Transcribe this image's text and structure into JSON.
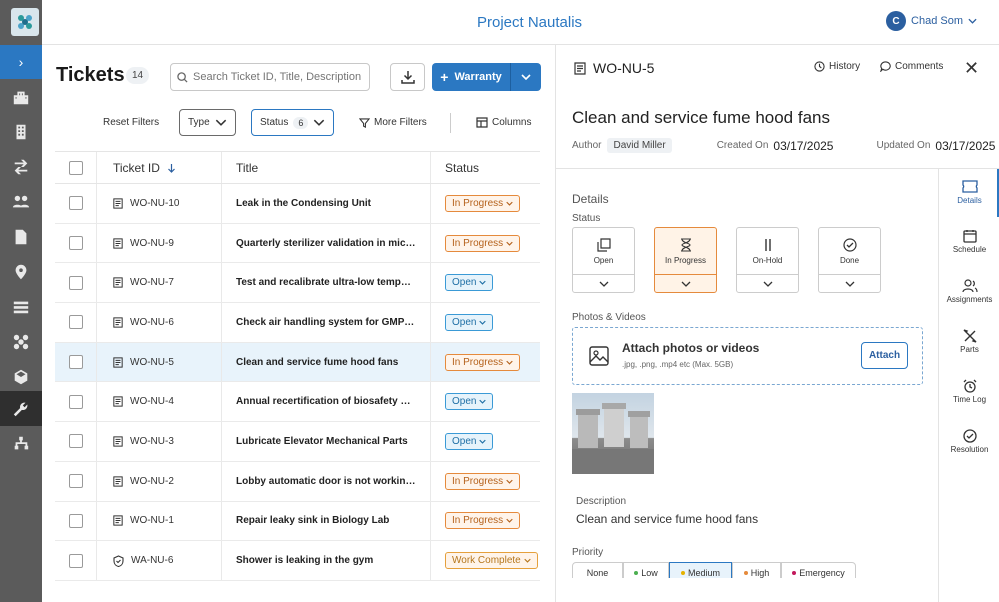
{
  "app": {
    "project_name": "Project Nautalis",
    "user_initial": "C",
    "user_name": "Chad Som"
  },
  "sidebar": {
    "items": [
      "expand-icon",
      "buildings-icon",
      "building-icon",
      "transfer-icon",
      "people-icon",
      "document-icon",
      "location-icon",
      "server-icon",
      "parts-icon",
      "package-icon",
      "wrench-icon",
      "hierarchy-icon"
    ],
    "active": "wrench-icon"
  },
  "list": {
    "title": "Tickets",
    "count": "14",
    "search_placeholder": "Search Ticket ID, Title, Description",
    "warranty_label": "Warranty",
    "filters": {
      "reset": "Reset Filters",
      "type": "Type",
      "status": "Status",
      "status_count": "6",
      "more": "More Filters",
      "columns": "Columns"
    },
    "columns": {
      "id": "Ticket ID",
      "title": "Title",
      "status": "Status"
    },
    "rows": [
      {
        "id": "WO-NU-10",
        "title": "Leak in the Condensing Unit",
        "status": "In Progress",
        "kind": "inprogress"
      },
      {
        "id": "WO-NU-9",
        "title": "Quarterly sterilizer validation in microbi...",
        "status": "In Progress",
        "kind": "inprogress"
      },
      {
        "id": "WO-NU-7",
        "title": "Test and recalibrate ultra-low temperat...",
        "status": "Open",
        "kind": "open"
      },
      {
        "id": "WO-NU-6",
        "title": "Check air handling system for GMP co...",
        "status": "Open",
        "kind": "open"
      },
      {
        "id": "WO-NU-5",
        "title": "Clean and service fume hood fans",
        "status": "In Progress",
        "kind": "inprogress"
      },
      {
        "id": "WO-NU-4",
        "title": "Annual recertification of biosafety cabi...",
        "status": "Open",
        "kind": "open"
      },
      {
        "id": "WO-NU-3",
        "title": "Lubricate Elevator Mechanical Parts",
        "status": "Open",
        "kind": "open"
      },
      {
        "id": "WO-NU-2",
        "title": "Lobby automatic door is not working pr...",
        "status": "In Progress",
        "kind": "inprogress"
      },
      {
        "id": "WO-NU-1",
        "title": "Repair leaky sink in Biology Lab",
        "status": "In Progress",
        "kind": "inprogress"
      },
      {
        "id": "WA-NU-6",
        "title": "Shower is leaking in the gym",
        "status": "Work Complete",
        "kind": "workcomplete"
      }
    ]
  },
  "detail": {
    "id": "WO-NU-5",
    "history": "History",
    "comments": "Comments",
    "title": "Clean and service fume hood fans",
    "author_label": "Author",
    "author": "David Miller",
    "created_label": "Created On",
    "created": "03/17/2025",
    "updated_label": "Updated On",
    "updated": "03/17/2025",
    "details_heading": "Details",
    "status_label": "Status",
    "statuses": [
      "Open",
      "In Progress",
      "On-Hold",
      "Done"
    ],
    "current_status": "In Progress",
    "photos_label": "Photos & Videos",
    "attach_title": "Attach photos or videos",
    "attach_sub": ".jpg, .png, .mp4 etc (Max. 5GB)",
    "attach_button": "Attach",
    "description_label": "Description",
    "description": "Clean and service fume hood fans",
    "priority_label": "Priority",
    "priorities": [
      "None",
      "Low",
      "Medium",
      "High",
      "Emergency"
    ],
    "current_priority": "Medium",
    "tabs": [
      "Details",
      "Schedule",
      "Assignments",
      "Parts",
      "Time Log",
      "Resolution"
    ]
  },
  "colors": {
    "accent": "#2b78c2",
    "in_progress": "#e58a3c",
    "open": "#3a9ad6",
    "sidebar": "#5b5b5b"
  }
}
